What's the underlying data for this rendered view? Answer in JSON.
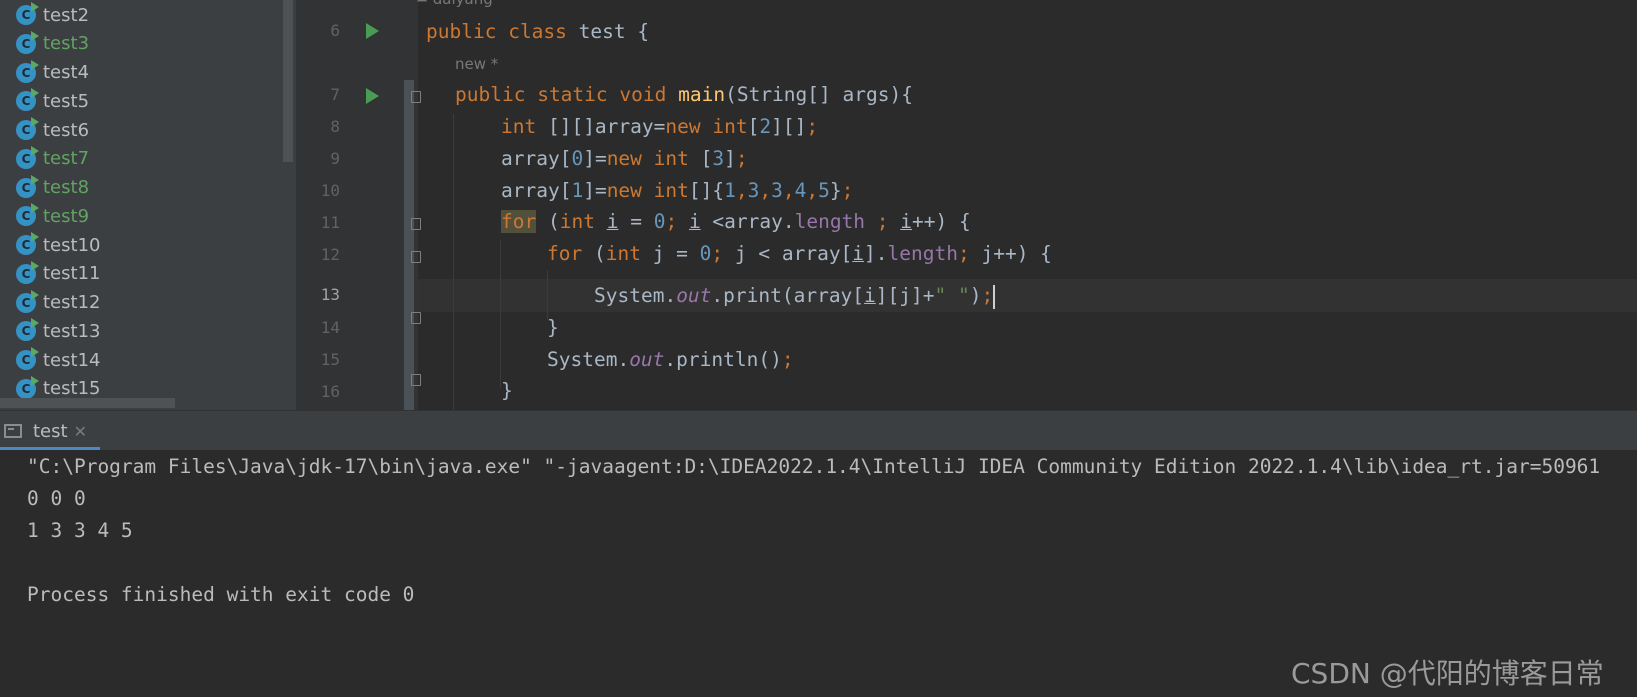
{
  "project_tree": {
    "items": [
      {
        "label": "test2",
        "modified": false
      },
      {
        "label": "test3",
        "modified": true
      },
      {
        "label": "test4",
        "modified": false
      },
      {
        "label": "test5",
        "modified": false
      },
      {
        "label": "test6",
        "modified": false
      },
      {
        "label": "test7",
        "modified": true
      },
      {
        "label": "test8",
        "modified": true
      },
      {
        "label": "test9",
        "modified": true
      },
      {
        "label": "test10",
        "modified": false
      },
      {
        "label": "test11",
        "modified": false
      },
      {
        "label": "test12",
        "modified": false
      },
      {
        "label": "test13",
        "modified": false
      },
      {
        "label": "test14",
        "modified": false
      },
      {
        "label": "test15",
        "modified": false
      }
    ],
    "class_icon_letter": "C"
  },
  "editor": {
    "author_hint": "daiyang",
    "new_hint": "new *",
    "line_numbers": [
      "6",
      "7",
      "8",
      "9",
      "10",
      "11",
      "12",
      "13",
      "14",
      "15",
      "16"
    ],
    "current_line": "13",
    "code": {
      "l6": {
        "kw_public": "public",
        "kw_class": "class",
        "rest": " test {"
      },
      "l7": {
        "kw1": "public",
        "kw2": "static",
        "kw3": "void",
        "fn": "main",
        "rest": "(String[] args){"
      },
      "l8": {
        "kw_int": "int",
        "mid": " [][]array=",
        "kw_new": "new",
        "kw_int2": "int",
        "pre": "[",
        "num": "2",
        "post": "][]",
        "semi": ";"
      },
      "l9": {
        "pre": "array[",
        "num": "0",
        "mid": "]=",
        "kw_new": "new",
        "kw_int": "int",
        "post1": " [",
        "num2": "3",
        "post2": "]",
        "semi": ";"
      },
      "l10": {
        "pre": "array[",
        "num": "1",
        "mid": "]=",
        "kw_new": "new",
        "kw_int": "int",
        "braces": "[]{",
        "n1": "1",
        "n2": "3",
        "n3": "3",
        "n4": "4",
        "n5": "5",
        "close": "}",
        "semi": ";"
      },
      "l11": {
        "kw_for": "for",
        "open": " (",
        "kw_int": "int",
        "var_i": "i",
        "eq": " = ",
        "zero": "0",
        "semi1": ";",
        "var_i2": "i",
        "lt": " <array.",
        "field": "length",
        "semi2": " ;",
        "var_i3": "i",
        "inc": "++) {"
      },
      "l12": {
        "kw_for": "for",
        "open": " (",
        "kw_int": "int",
        "decl": " j = ",
        "zero": "0",
        "semi1": ";",
        "cond": " j < array[",
        "var_i": "i",
        "close": "].",
        "field": "length",
        "semi2": ";",
        "inc": " j++) {"
      },
      "l13": {
        "pre": "System.",
        "out": "out",
        "call": ".print(array[",
        "var_i": "i",
        "idx": "][j]+",
        "str": "\" \"",
        "close": ")",
        "semi": ";"
      },
      "l14": {
        "text": "}"
      },
      "l15": {
        "pre": "System.",
        "out": "out",
        "call": ".println()",
        "semi": ";"
      },
      "l16": {
        "text": "}"
      }
    }
  },
  "run_panel": {
    "tab_label": "test",
    "tab_close": "✕",
    "console_lines": [
      "\"C:\\Program Files\\Java\\jdk-17\\bin\\java.exe\" \"-javaagent:D:\\IDEA2022.1.4\\IntelliJ IDEA Community Edition 2022.1.4\\lib\\idea_rt.jar=50961",
      "0 0 0",
      "1 3 3 4 5",
      "",
      "Process finished with exit code 0"
    ]
  },
  "watermark": "CSDN @代阳的博客日常",
  "colors": {
    "keyword": "#cc7832",
    "number": "#6897bb",
    "method": "#ffc66d",
    "field": "#9876aa",
    "string": "#6a8759",
    "modified_file": "#62a362",
    "background": "#2b2b2b"
  }
}
